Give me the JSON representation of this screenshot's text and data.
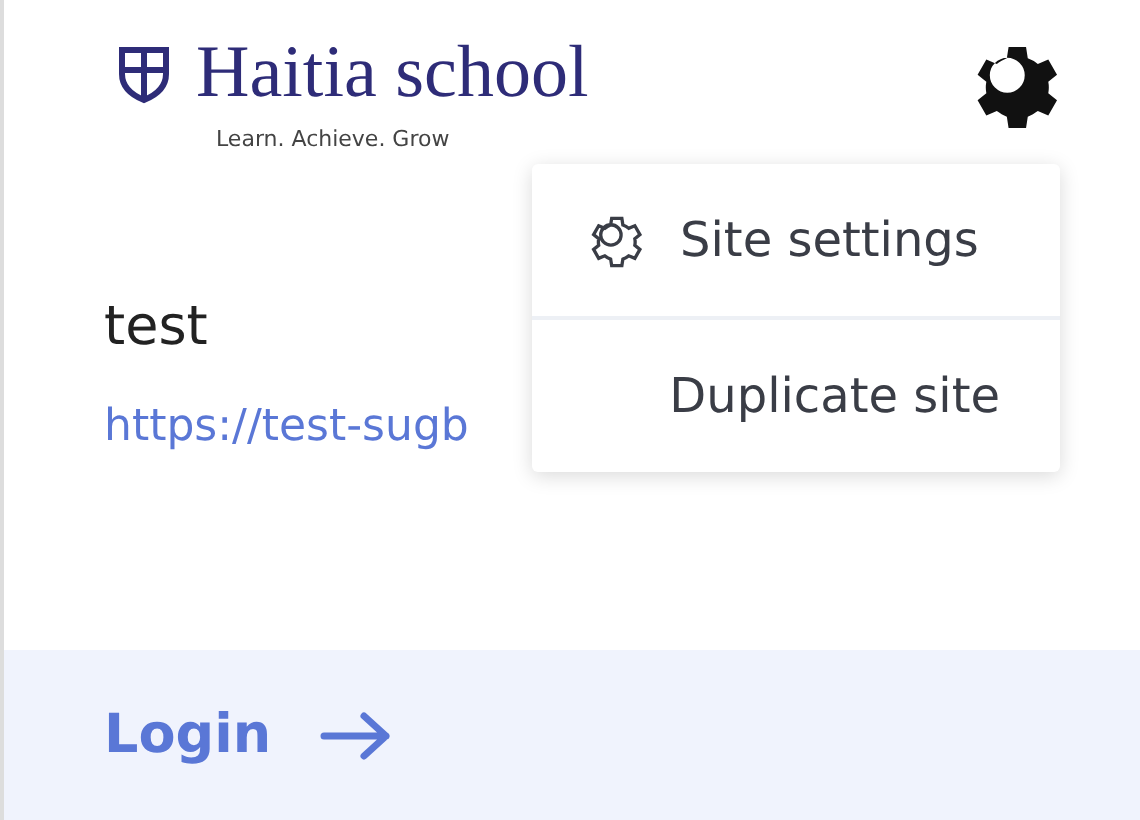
{
  "brand": {
    "name": "Haitia school",
    "tagline": "Learn. Achieve. Grow"
  },
  "site": {
    "name": "test",
    "url": "https://test-sugb"
  },
  "menu": {
    "open": true,
    "items": [
      {
        "label": "Site settings",
        "kind": "icon"
      },
      {
        "label": "Duplicate site",
        "kind": "plain"
      }
    ]
  },
  "login": {
    "label": "Login"
  }
}
